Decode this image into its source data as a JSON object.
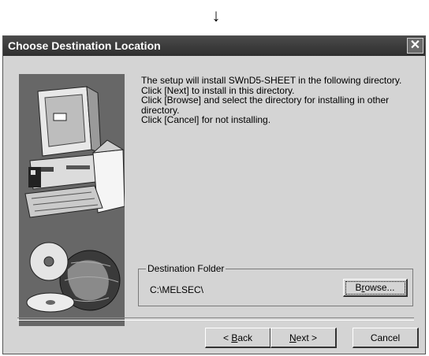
{
  "page": {
    "arrow": "↓"
  },
  "window": {
    "title": "Choose Destination Location",
    "close_glyph": "✕"
  },
  "message": {
    "lines": [
      "The setup will install SWnD5-SHEET in the following directory.",
      "Click [Next] to install in this directory.",
      "Click [Browse] and select the directory for installing in other",
      "directory.",
      "Click [Cancel] for not installing."
    ]
  },
  "destination": {
    "group_label": "Destination Folder",
    "path": "C:\\MELSEC\\",
    "browse": {
      "pre": "B",
      "mnemonic": "r",
      "post": "owse..."
    }
  },
  "buttons": {
    "back": {
      "pre": "< ",
      "mnemonic": "B",
      "post": "ack"
    },
    "next": {
      "pre": "",
      "mnemonic": "N",
      "post": "ext >"
    },
    "cancel": "Cancel"
  },
  "icons": {
    "art": "computer-disc-globe-illustration",
    "close": "close-icon"
  }
}
